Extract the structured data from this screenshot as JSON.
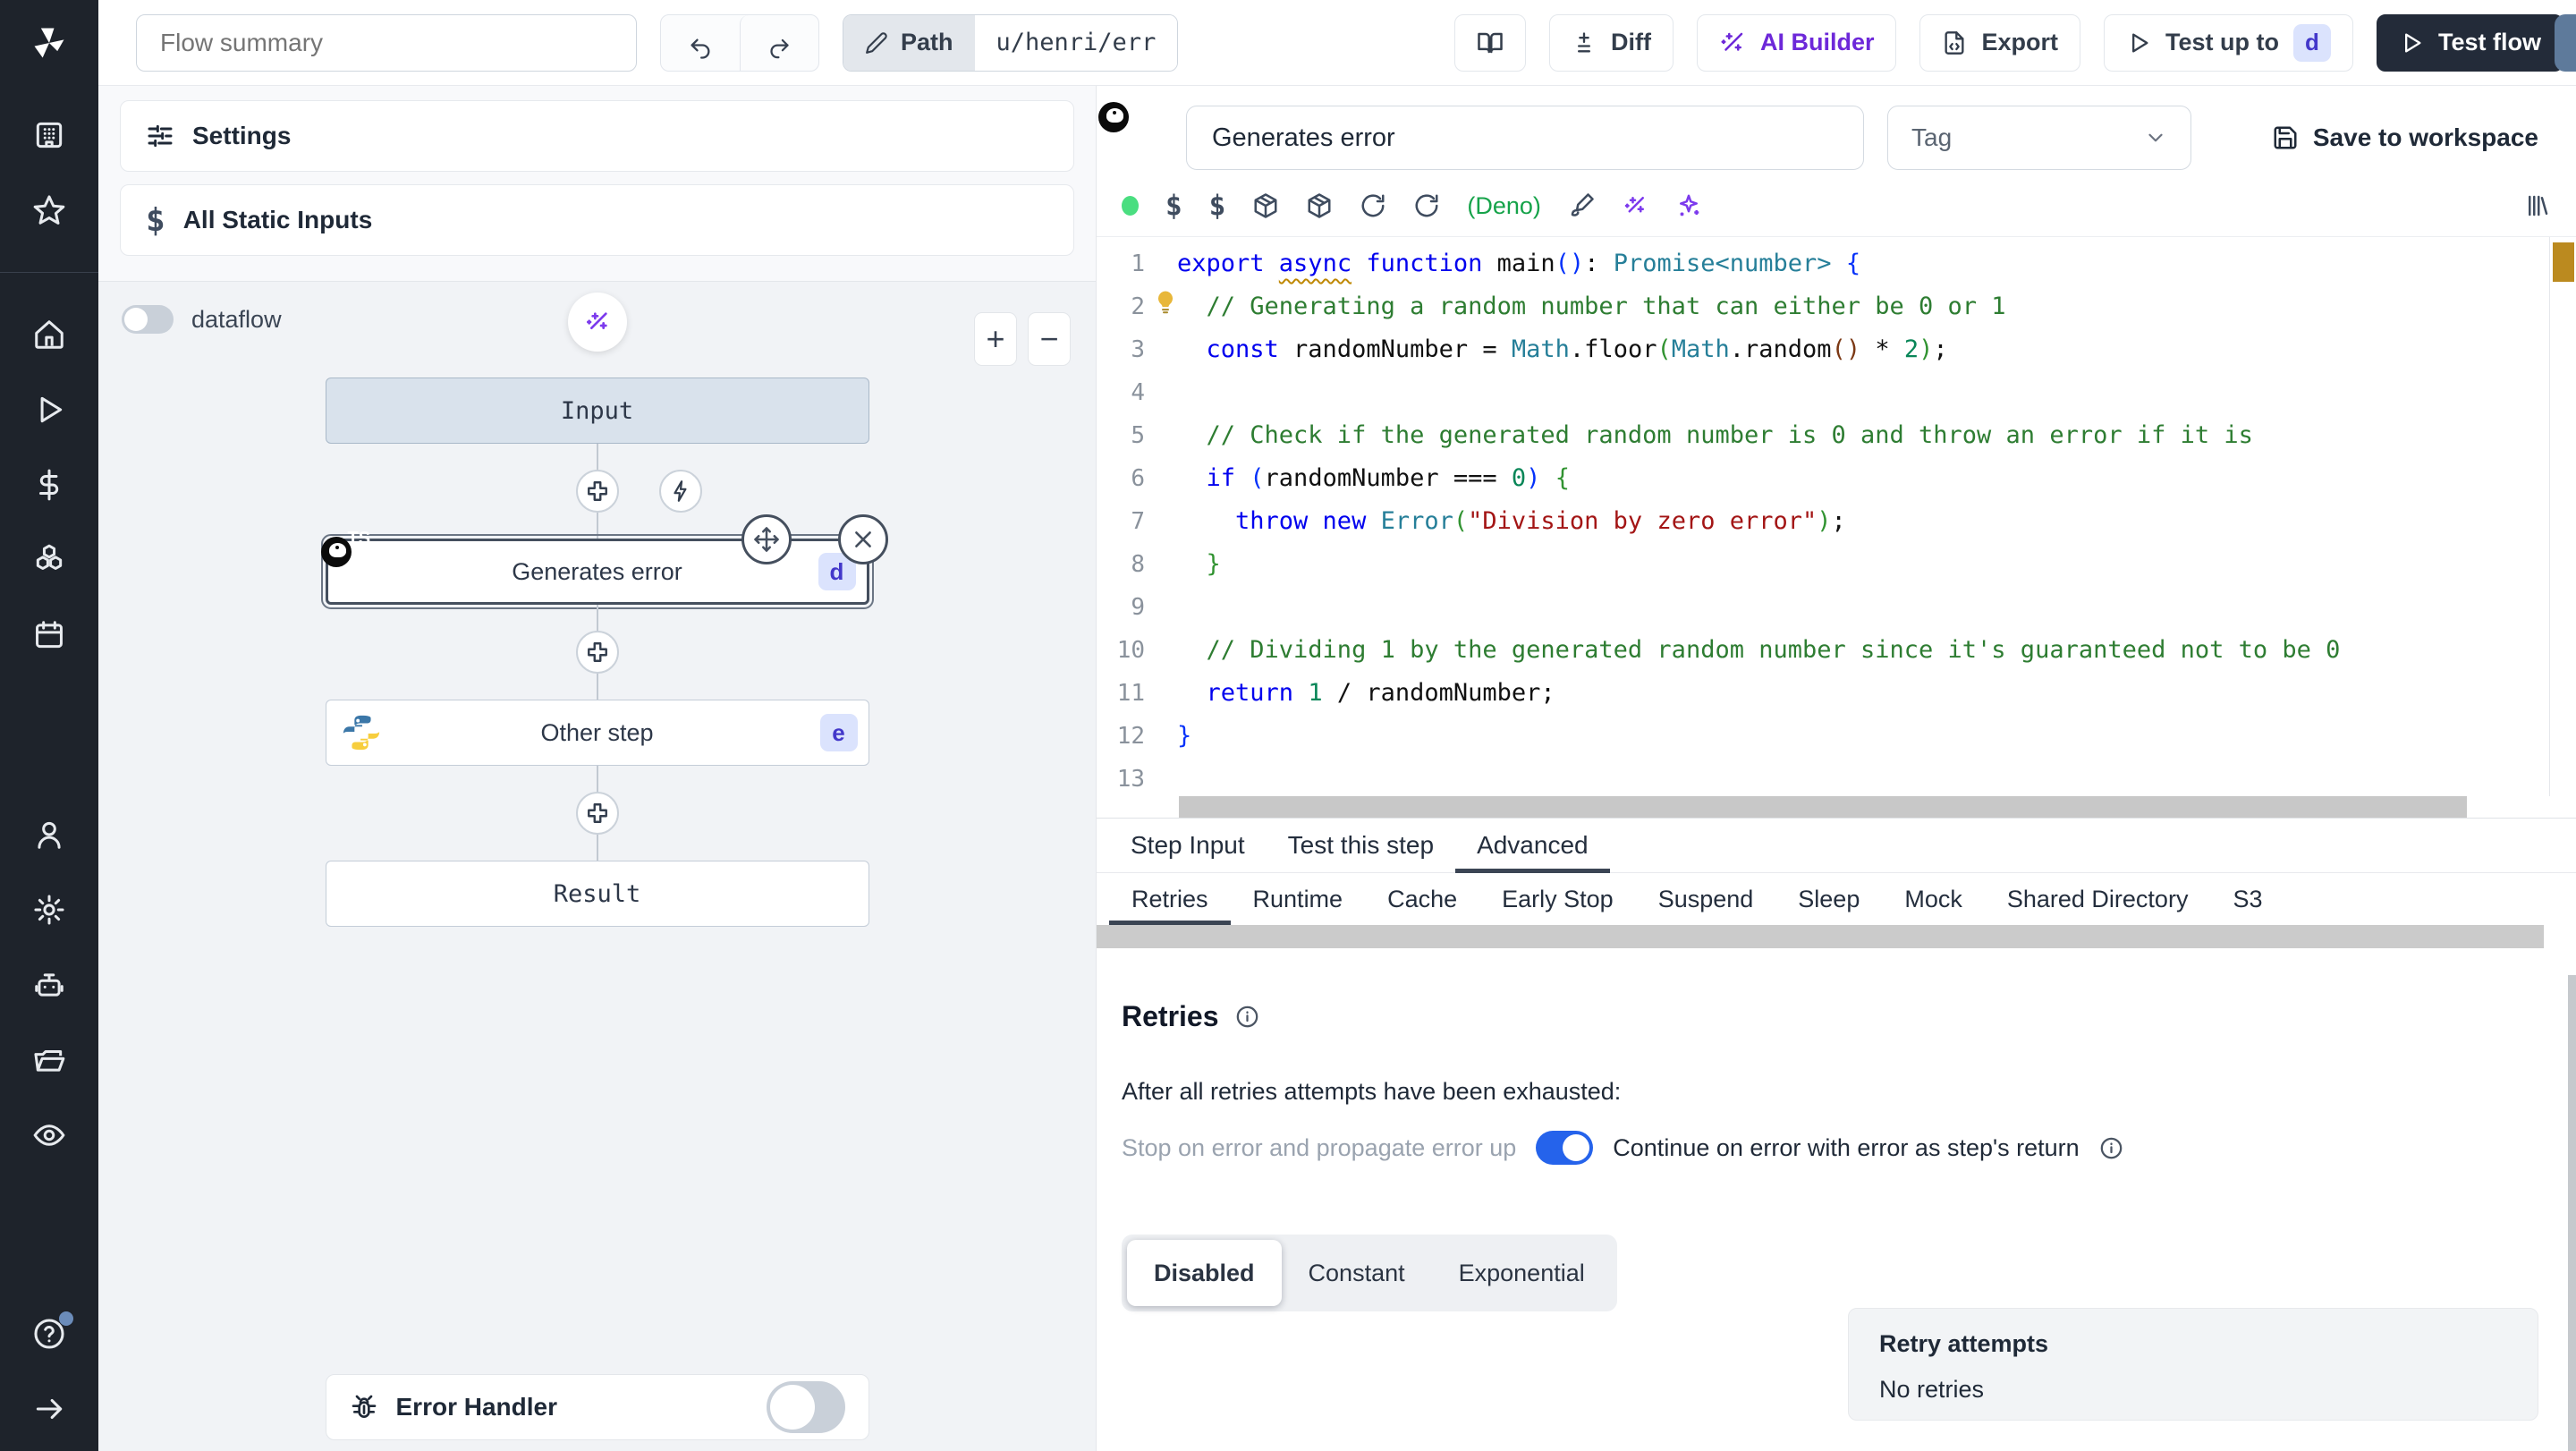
{
  "header": {
    "flow_summary_placeholder": "Flow summary",
    "path_label": "Path",
    "path_value": "u/henri/err",
    "diff_label": "Diff",
    "ai_builder_label": "AI Builder",
    "export_label": "Export",
    "test_up_to_label": "Test up to",
    "test_up_to_badge": "d",
    "test_flow_label": "Test flow"
  },
  "sidebar": {
    "top_icons": [
      "building",
      "star"
    ],
    "mid_icons": [
      "home",
      "play",
      "dollar",
      "boxes",
      "calendar"
    ],
    "low_icons": [
      "user",
      "gear",
      "bot",
      "folder",
      "eye"
    ],
    "bottom_icons": [
      "help",
      "arrow-right"
    ],
    "help_has_notification": true
  },
  "flow_panel": {
    "settings_label": "Settings",
    "static_inputs_label": "All Static Inputs",
    "dataflow_label": "dataflow",
    "zoom_in_label": "+",
    "zoom_out_label": "−",
    "nodes": {
      "input": {
        "label": "Input"
      },
      "step_d": {
        "label": "Generates error",
        "badge": "d",
        "language": "typescript-deno",
        "selected": true
      },
      "step_e": {
        "label": "Other step",
        "badge": "e",
        "language": "python"
      },
      "result": {
        "label": "Result"
      }
    },
    "error_handler_label": "Error Handler",
    "error_handler_enabled": false
  },
  "step_editor": {
    "icon": "typescript-deno",
    "name_value": "Generates error",
    "tag_placeholder": "Tag",
    "save_label": "Save to workspace",
    "runtime_label": "(Deno)",
    "status_color": "#4ade80"
  },
  "editor_code": {
    "language": "typescript",
    "lines": [
      {
        "n": 1,
        "tokens": [
          [
            "kw",
            "export "
          ],
          [
            "kwu",
            "async"
          ],
          [
            "kw",
            " function "
          ],
          [
            "pl",
            "main"
          ],
          [
            "b1",
            "()"
          ],
          [
            "pl",
            ": "
          ],
          [
            "ty",
            "Promise<number>"
          ],
          [
            "pl",
            " "
          ],
          [
            "b1",
            "{"
          ]
        ]
      },
      {
        "n": 2,
        "bulb": true,
        "tokens": [
          [
            "cmt",
            "  // Generating a random number that can either be 0 or 1"
          ]
        ]
      },
      {
        "n": 3,
        "tokens": [
          [
            "kw",
            "  const "
          ],
          [
            "pl",
            "randomNumber = "
          ],
          [
            "ty",
            "Math"
          ],
          [
            "pl",
            ".floor"
          ],
          [
            "b2",
            "("
          ],
          [
            "ty",
            "Math"
          ],
          [
            "pl",
            ".random"
          ],
          [
            "b3",
            "()"
          ],
          [
            "pl",
            " * "
          ],
          [
            "num",
            "2"
          ],
          [
            "b2",
            ")"
          ],
          [
            "pl",
            ";"
          ]
        ]
      },
      {
        "n": 4,
        "tokens": []
      },
      {
        "n": 5,
        "tokens": [
          [
            "cmt",
            "  // Check if the generated random number is 0 and throw an error if it is"
          ]
        ]
      },
      {
        "n": 6,
        "tokens": [
          [
            "kw",
            "  if "
          ],
          [
            "b1",
            "("
          ],
          [
            "pl",
            "randomNumber === "
          ],
          [
            "num",
            "0"
          ],
          [
            "b1",
            ")"
          ],
          [
            "pl",
            " "
          ],
          [
            "b2",
            "{"
          ]
        ]
      },
      {
        "n": 7,
        "tokens": [
          [
            "kw",
            "    throw new "
          ],
          [
            "ty",
            "Error"
          ],
          [
            "b2",
            "("
          ],
          [
            "str",
            "\"Division by zero error\""
          ],
          [
            "b2",
            ")"
          ],
          [
            "pl",
            ";"
          ]
        ]
      },
      {
        "n": 8,
        "tokens": [
          [
            "b2",
            "  }"
          ]
        ]
      },
      {
        "n": 9,
        "tokens": []
      },
      {
        "n": 10,
        "tokens": [
          [
            "cmt",
            "  // Dividing 1 by the generated random number since it's guaranteed not to be 0"
          ]
        ]
      },
      {
        "n": 11,
        "tokens": [
          [
            "kw",
            "  return "
          ],
          [
            "num",
            "1"
          ],
          [
            "pl",
            " / randomNumber;"
          ]
        ]
      },
      {
        "n": 12,
        "tokens": [
          [
            "b1",
            "}"
          ]
        ]
      },
      {
        "n": 13,
        "tokens": []
      }
    ]
  },
  "panel_tabs": {
    "items": [
      "Step Input",
      "Test this step",
      "Advanced"
    ],
    "active": "Advanced"
  },
  "advanced_subtabs": {
    "items": [
      "Retries",
      "Runtime",
      "Cache",
      "Early Stop",
      "Suspend",
      "Sleep",
      "Mock",
      "Shared Directory",
      "S3"
    ],
    "active": "Retries"
  },
  "retries": {
    "title": "Retries",
    "exhausted_text": "After all retries attempts have been exhausted:",
    "toggle_off_label": "Stop on error and propagate error up",
    "toggle_on_label": "Continue on error with error as step's return",
    "toggle_state": true,
    "mode_tabs": [
      "Disabled",
      "Constant",
      "Exponential"
    ],
    "mode_active": "Disabled",
    "retry_attempts_title": "Retry attempts",
    "retry_attempts_value": "No retries"
  },
  "colors": {
    "accent_blue_toggle": "#2563eb",
    "badge_bg": "#dbe3fd",
    "badge_text": "#4338ca",
    "deno_green": "#16a34a",
    "ai_purple": "#7c3aed",
    "sidebar_bg": "#1e232b",
    "ruler_marker": "#bb8a1f"
  }
}
